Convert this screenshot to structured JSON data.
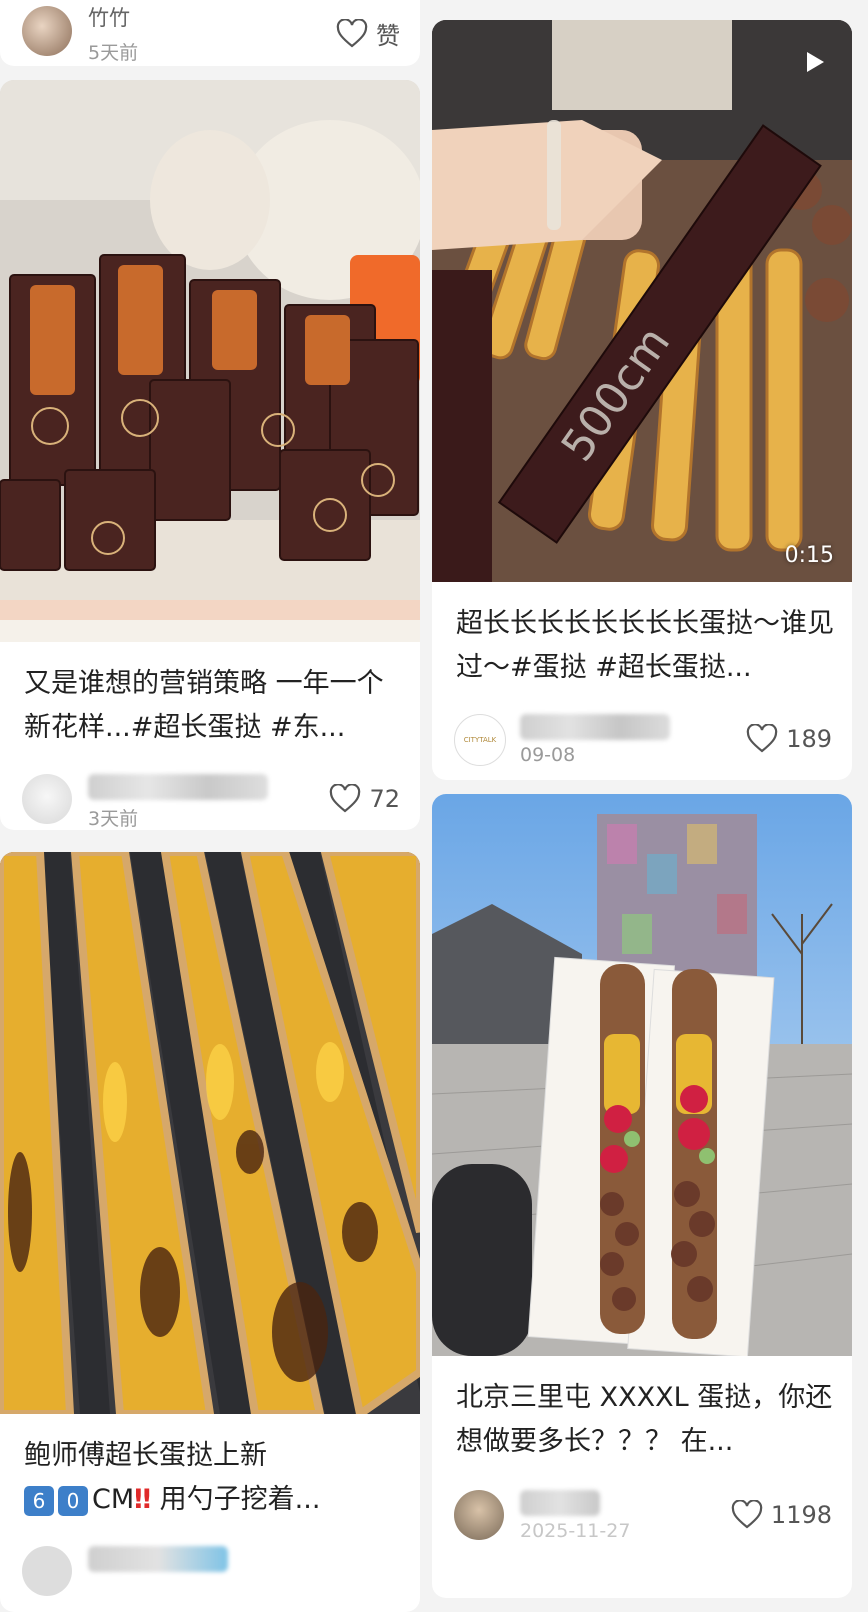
{
  "colors": {
    "background": "#f3f3f3",
    "card": "#ffffff",
    "text": "#222222",
    "muted": "#9a9a9a"
  },
  "top_meta": {
    "user_name": "竹竹",
    "date": "5天前",
    "like_label": "赞"
  },
  "posts": [
    {
      "title": "又是谁想的营销策略 一年一个新花样...#超长蛋挞 #东...",
      "date": "3天前",
      "likes": "72",
      "image_alt": "boxed-long-egg-tarts"
    },
    {
      "title": "超长长长长长长长长蛋挞～谁见过～#蛋挞 #超长蛋挞...",
      "date": "09-08",
      "likes": "189",
      "video_duration": "0:15",
      "image_alt": "egg-tart-box-video",
      "box_text": "500cm",
      "avatar_text": "CITYTALK"
    },
    {
      "title": "鲍师傅超长蛋挞上新 6⃣0⃣CM‼️ 用勺子挖着...",
      "image_alt": "long-egg-tarts-tray",
      "title_line1": "鲍师傅超长蛋挞上新",
      "title_keycaps": [
        "6",
        "0"
      ],
      "title_line2_rest": "CM",
      "title_exclaim": "‼",
      "title_line2_tail": " 用勺子挖着..."
    },
    {
      "title": "北京三里屯 XXXXL 蛋挞，你还想做要多长？？？ 在...",
      "date": "2025-11-27",
      "likes": "1198",
      "image_alt": "sanlitun-xl-egg-tart"
    }
  ]
}
